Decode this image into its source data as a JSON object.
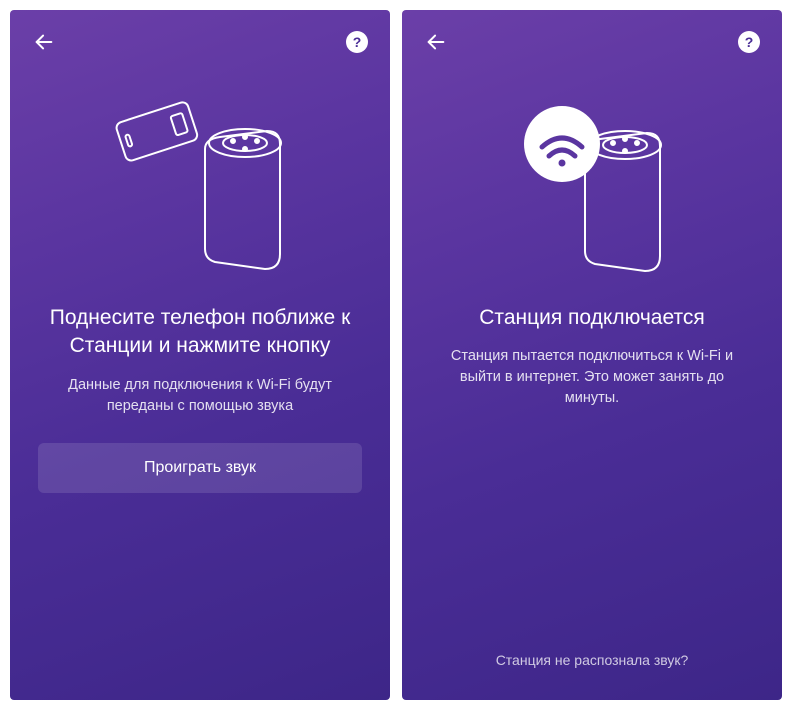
{
  "screen1": {
    "title": "Поднесите телефон поближе  к Станции и нажмите кнопку",
    "subtitle": "Данные для подключения к Wi-Fi будут переданы с помощью звука",
    "button_label": "Проиграть звук",
    "help_label": "?"
  },
  "screen2": {
    "title": "Станция подключается",
    "subtitle": "Станция пытается подключиться к Wi-Fi и выйти в интернет. Это может занять до минуты.",
    "footer_link": "Станция не распознала звук?",
    "help_label": "?"
  }
}
